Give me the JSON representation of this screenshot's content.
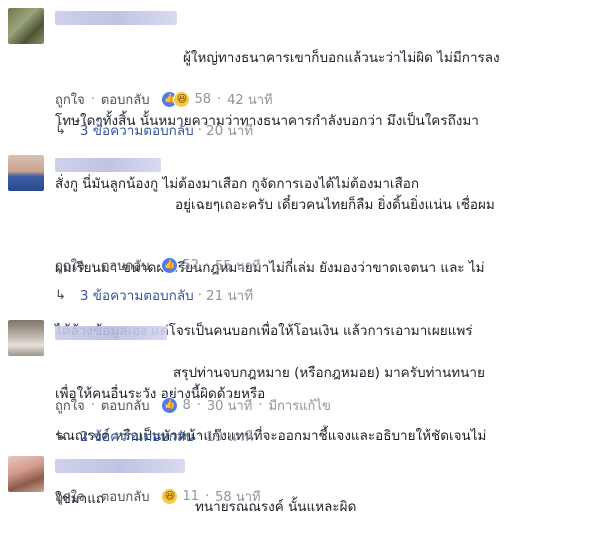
{
  "comments": [
    {
      "text_lines": [
        "ผู้ใหญ่ทางธนาคารเขาก็บอกแล้วนะว่าไม่ผิด ไม่มีการลง",
        "โทษใดๆทั้งสิ้น นั้นหมายความว่าทางธนาคารกำลังบอกว่า มึงเป็นใครถึงมา",
        "สั่งกู นี่มันลูกน้องกู ไม่ต้องมาเสือก กูจัดการเองได้ไม่ต้องมาเสือก"
      ],
      "like_label": "ถูกใจ",
      "reply_label": "ตอบกลับ",
      "reaction_count": "58",
      "time": "42 นาที",
      "edited": "",
      "replies_text": "3 ข้อความตอบกลับ",
      "replies_time": "20 นาที"
    },
    {
      "text_lines": [
        "อยู่เฉยๆเถอะครับ เดี๋ยวคนไทยก็ลืม ยิ่งดิ้นยิ่งแน่น เชื่อผม",
        "ผมเรียนมา ขนาดผมเรียนกฎหมายมาไม่กี่เล่ม ยังมองว่าขาดเจตนา และ ไม่",
        "ได้ล้วงข้อมูลเอง แต่โจรเป็นคนบอกเพื่อให้โอนเงิน แล้วการเอามาเผยแพร่",
        "เพื่อให้คนอื่นระวัง อย่างนี้ผิดด้วยหรือ"
      ],
      "like_label": "ถูกใจ",
      "reply_label": "ตอบกลับ",
      "reaction_count": "52",
      "time": "55 นาที",
      "edited": "",
      "replies_text": "3 ข้อความตอบกลับ",
      "replies_time": "21 นาที"
    },
    {
      "text_lines": [
        "สรุปท่านจบกฎหมาย (หรือกฎหมอย) มาครับท่านทนาย",
        "รณณรงค์ หรือเป็นหัวหน้าแก๊งแทนที่จะออกมาชี้แจงและอธิบายให้ชัดเจนไม่",
        "ใช่มาแถ"
      ],
      "like_label": "ถูกใจ",
      "reply_label": "ตอบกลับ",
      "reaction_count": "8",
      "time": "30 นาที",
      "edited": "มีการแก้ไข",
      "replies_text": "2 ข้อความตอบกลับ",
      "replies_time": "19 นาที"
    },
    {
      "text_lines": [
        "ทนายรณณรงค์ นั้นแหละผิด"
      ],
      "like_label": "ถูกใจ",
      "reply_label": "ตอบกลับ",
      "reaction_count": "11",
      "time": "58 นาที",
      "edited": "",
      "replies_text": "",
      "replies_time": ""
    }
  ],
  "colors": {
    "link": "#365899",
    "meta": "#90949c",
    "like_blue": "#4e7bf2",
    "haha_yellow": "#f7c843"
  },
  "icons": [
    "like-reaction-icon",
    "haha-reaction-icon",
    "reply-arrow-icon"
  ]
}
